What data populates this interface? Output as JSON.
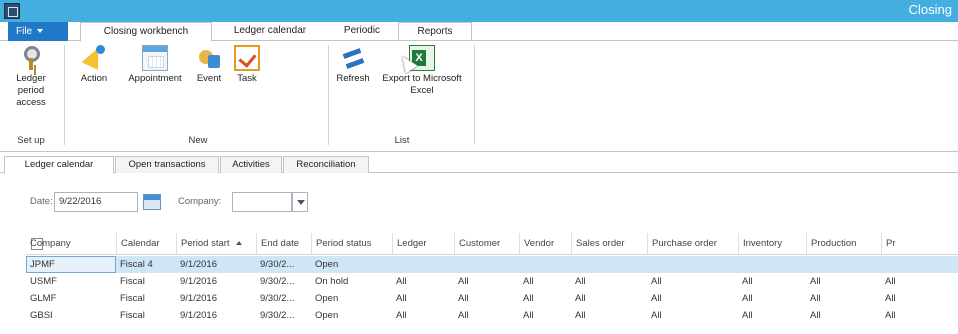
{
  "window": {
    "title": "Closing"
  },
  "ribbon_tabs": {
    "file": "File",
    "tabs": [
      "Closing workbench",
      "Ledger calendar",
      "Periodic",
      "Reports"
    ]
  },
  "ribbon": {
    "ledger_period_access": "Ledger period access",
    "action": "Action",
    "appointment": "Appointment",
    "event": "Event",
    "task": "Task",
    "refresh": "Refresh",
    "export_excel": "Export to Microsoft Excel",
    "groups": {
      "setup": "Set up",
      "new": "New",
      "list": "List"
    }
  },
  "content_tabs": [
    "Ledger calendar",
    "Open transactions",
    "Activities",
    "Reconciliation"
  ],
  "filter": {
    "date_label": "Date:",
    "date_value": "9/22/2016",
    "company_label": "Company:",
    "company_value": ""
  },
  "grid": {
    "columns": [
      "Company",
      "Calendar",
      "Period start",
      "End date",
      "Period status",
      "Ledger",
      "Customer",
      "Vendor",
      "Sales order",
      "Purchase order",
      "Inventory",
      "Production",
      "Pr"
    ],
    "rows": [
      [
        "JPMF",
        "Fiscal 4",
        "9/1/2016",
        "9/30/2...",
        "Open",
        "",
        "",
        "",
        "",
        "",
        "",
        "",
        ""
      ],
      [
        "USMF",
        "Fiscal",
        "9/1/2016",
        "9/30/2...",
        "On hold",
        "All",
        "All",
        "All",
        "All",
        "All",
        "All",
        "All",
        "All"
      ],
      [
        "GLMF",
        "Fiscal",
        "9/1/2016",
        "9/30/2...",
        "Open",
        "All",
        "All",
        "All",
        "All",
        "All",
        "All",
        "All",
        "All"
      ],
      [
        "GBSI",
        "Fiscal",
        "9/1/2016",
        "9/30/2...",
        "Open",
        "All",
        "All",
        "All",
        "All",
        "All",
        "All",
        "All",
        "All"
      ]
    ]
  },
  "colors": {
    "titlebar": "#45aee0",
    "file_button": "#1f78c8",
    "selected_row": "#cfe6f6"
  }
}
